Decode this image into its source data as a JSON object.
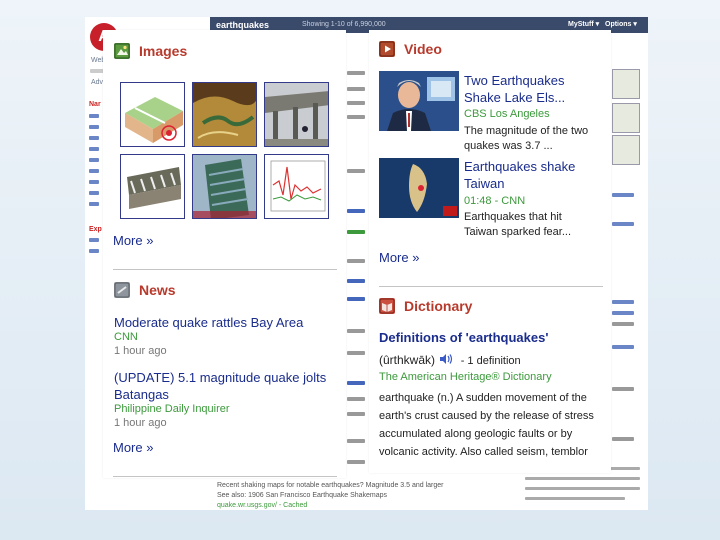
{
  "background_page": {
    "query": "earthquakes",
    "showing": "Showing 1-10 of 6,990,000",
    "mystuff": "MyStuff ▾",
    "options": "Options ▾",
    "logo_letter": "A",
    "bottom_result_line1": "Recent shaking maps for notable earthquakes? Magnitude 3.5 and larger",
    "bottom_result_line2": "See also: 1906 San Francisco Earthquake Shakemaps",
    "bottom_result_url": "quake.wr.usgs.gov/ - Cached"
  },
  "images": {
    "title": "Images",
    "icon": "images-icon",
    "more": "More »"
  },
  "news": {
    "title": "News",
    "icon": "news-icon",
    "items": [
      {
        "title": "Moderate quake rattles Bay Area",
        "source": "CNN",
        "time": "1 hour ago"
      },
      {
        "title": "(UPDATE) 5.1 magnitude quake jolts Batangas",
        "source": "Philippine Daily Inquirer",
        "time": "1 hour ago"
      }
    ],
    "more": "More »"
  },
  "video": {
    "title": "Video",
    "icon": "video-play-icon",
    "items": [
      {
        "title": "Two Earthquakes Shake Lake Els...",
        "source": "CBS Los Angeles",
        "snippet": "The magnitude of the two quakes was 3.7 ..."
      },
      {
        "title": "Earthquakes shake Taiwan",
        "source": "01:48 - CNN",
        "snippet": "Earthquakes that hit Taiwan sparked fear..."
      }
    ],
    "more": "More »"
  },
  "dictionary": {
    "title": "Dictionary",
    "icon": "dictionary-icon",
    "heading": "Definitions of 'earthquakes'",
    "pronunciation": "(ûrthkwāk)",
    "definition_count": "- 1 definition",
    "source": "The American Heritage® Dictionary",
    "definition": "earthquake   (n.)   A sudden movement of the earth's crust caused by the release of stress accumulated along geologic faults or by volcanic activity. Also called seism, temblor"
  },
  "colors": {
    "section_title": "#b83a2c",
    "link": "#1a2c8c",
    "source_green": "#3c9a3c",
    "bg_bar": "#3a4a6a"
  }
}
